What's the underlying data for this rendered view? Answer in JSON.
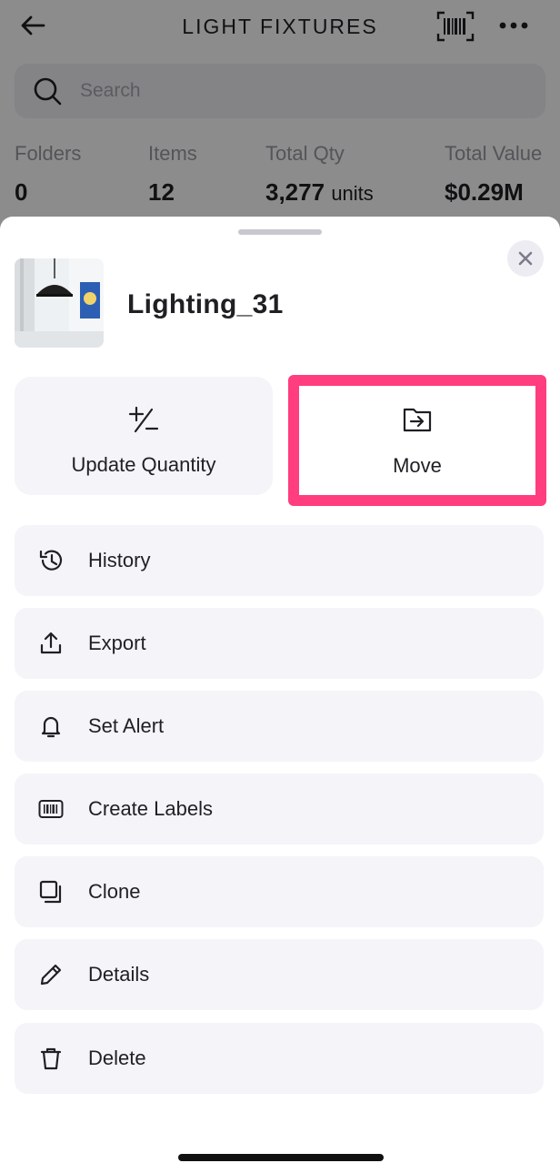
{
  "header": {
    "title": "LIGHT FIXTURES",
    "back_icon": "arrow-left-icon",
    "barcode_icon": "barcode-scan-icon",
    "more_icon": "more-horizontal-icon"
  },
  "search": {
    "placeholder": "Search",
    "icon": "search-icon"
  },
  "stats": [
    {
      "label": "Folders",
      "value": "0",
      "unit": ""
    },
    {
      "label": "Items",
      "value": "12",
      "unit": ""
    },
    {
      "label": "Total Qty",
      "value": "3,277",
      "unit": "units"
    },
    {
      "label": "Total Value",
      "value": "$0.29M",
      "unit": ""
    }
  ],
  "sheet": {
    "item_name": "Lighting_31",
    "close_icon": "close-icon",
    "actions": [
      {
        "label": "Update Quantity",
        "icon": "plus-minus-icon"
      },
      {
        "label": "Move",
        "icon": "folder-move-icon"
      }
    ],
    "menu": [
      {
        "label": "History",
        "icon": "history-icon"
      },
      {
        "label": "Export",
        "icon": "export-icon"
      },
      {
        "label": "Set Alert",
        "icon": "bell-icon"
      },
      {
        "label": "Create Labels",
        "icon": "barcode-icon"
      },
      {
        "label": "Clone",
        "icon": "clone-icon"
      },
      {
        "label": "Details",
        "icon": "pencil-icon"
      },
      {
        "label": "Delete",
        "icon": "trash-icon"
      }
    ]
  },
  "colors": {
    "highlight": "#ff3d7f",
    "card_bg": "#f4f4f9",
    "text": "#1f1f24"
  }
}
